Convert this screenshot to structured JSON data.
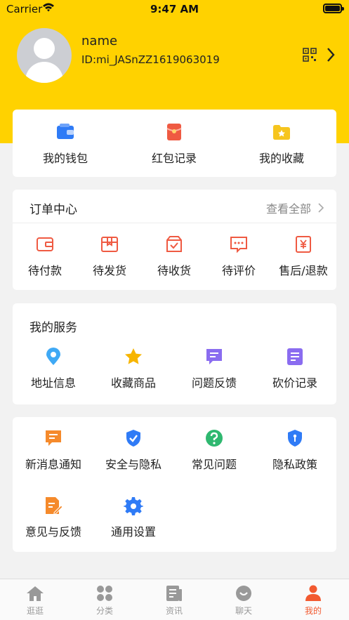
{
  "status": {
    "carrier": "Carrier",
    "time": "9:47 AM"
  },
  "profile": {
    "name": "name",
    "id": "ID:mi_JASnZZ1619063019"
  },
  "quick": [
    {
      "label": "我的钱包",
      "icon": "wallet-icon",
      "color": "#2f7bf6"
    },
    {
      "label": "红包记录",
      "icon": "red-envelope-icon",
      "color": "#ef5a42"
    },
    {
      "label": "我的收藏",
      "icon": "star-folder-icon",
      "color": "#f6c51e"
    }
  ],
  "orders": {
    "title": "订单中心",
    "more": "查看全部",
    "items": [
      {
        "label": "待付款",
        "icon": "wallet-pay-icon"
      },
      {
        "label": "待发货",
        "icon": "package-icon"
      },
      {
        "label": "待收货",
        "icon": "receive-box-icon"
      },
      {
        "label": "待评价",
        "icon": "comment-icon"
      },
      {
        "label": "售后/退款",
        "icon": "refund-icon"
      }
    ],
    "color": "#ef5a42"
  },
  "services": {
    "title": "我的服务",
    "items": [
      {
        "label": "地址信息",
        "icon": "location-pin-icon",
        "color": "#3fa9f5"
      },
      {
        "label": "收藏商品",
        "icon": "star-icon",
        "color": "#f7b500"
      },
      {
        "label": "问题反馈",
        "icon": "feedback-icon",
        "color": "#8a6cf0"
      },
      {
        "label": "砍价记录",
        "icon": "note-icon",
        "color": "#8a6cf0"
      }
    ]
  },
  "settings": {
    "items": [
      {
        "label": "新消息通知",
        "icon": "message-icon",
        "color": "#f58a2b"
      },
      {
        "label": "安全与隐私",
        "icon": "shield-check-icon",
        "color": "#2f7bf6"
      },
      {
        "label": "常见问题",
        "icon": "question-icon",
        "color": "#2fb870"
      },
      {
        "label": "隐私政策",
        "icon": "privacy-shield-icon",
        "color": "#2f7bf6"
      },
      {
        "label": "意见与反馈",
        "icon": "edit-doc-icon",
        "color": "#f58a2b"
      },
      {
        "label": "通用设置",
        "icon": "gear-icon",
        "color": "#2f7bf6"
      }
    ]
  },
  "tabs": [
    {
      "label": "逛逛",
      "icon": "home-icon"
    },
    {
      "label": "分类",
      "icon": "category-icon"
    },
    {
      "label": "资讯",
      "icon": "news-icon"
    },
    {
      "label": "聊天",
      "icon": "chat-icon"
    },
    {
      "label": "我的",
      "icon": "profile-icon",
      "active": true
    }
  ],
  "colors": {
    "accent": "#ffd200",
    "active_tab": "#f25a30"
  }
}
